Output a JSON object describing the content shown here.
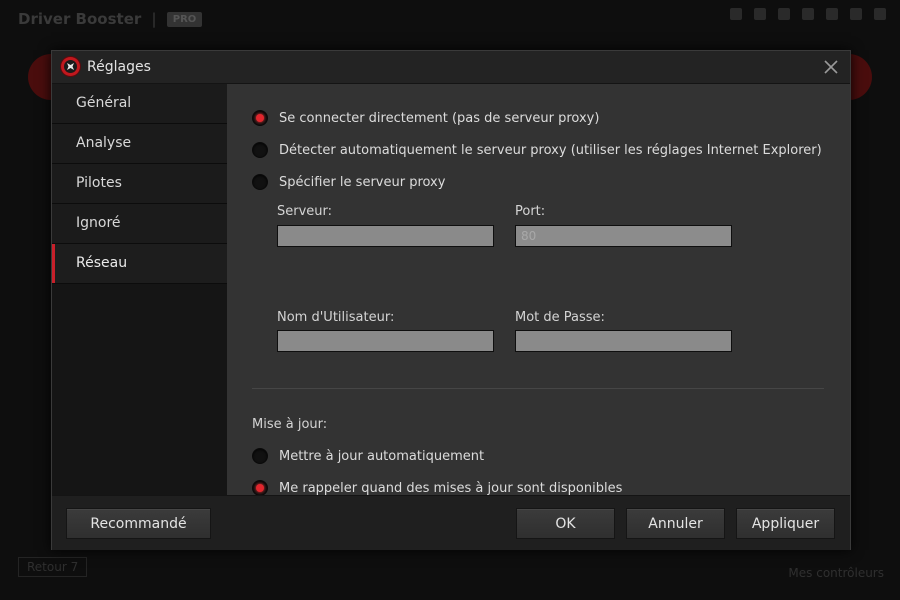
{
  "background": {
    "title": "Driver Booster",
    "badge": "PRO",
    "footer_left": "Retour 7",
    "footer_right": "Mes contrôleurs"
  },
  "dialog": {
    "title": "Réglages",
    "icons": {
      "logo": "app-logo-icon",
      "close": "close-icon"
    }
  },
  "sidebar": {
    "items": [
      {
        "label": "Général",
        "active": false
      },
      {
        "label": "Analyse",
        "active": false
      },
      {
        "label": "Pilotes",
        "active": false
      },
      {
        "label": "Ignoré",
        "active": false
      },
      {
        "label": "Réseau",
        "active": true
      }
    ]
  },
  "network": {
    "proxy_options": [
      {
        "label": "Se connecter directement (pas de serveur proxy)",
        "checked": true
      },
      {
        "label": "Détecter automatiquement le serveur proxy (utiliser les réglages Internet Explorer)",
        "checked": false
      },
      {
        "label": "Spécifier le serveur proxy",
        "checked": false
      }
    ],
    "server_label": "Serveur:",
    "server_value": "",
    "port_label": "Port:",
    "port_placeholder": "80",
    "username_label": "Nom d'Utilisateur:",
    "username_value": "",
    "password_label": "Mot de Passe:",
    "password_value": "",
    "update_label": "Mise à jour:",
    "update_options": [
      {
        "label": "Mettre à jour automatiquement",
        "checked": false
      },
      {
        "label": "Me rappeler quand des mises à jour sont disponibles",
        "checked": true
      }
    ]
  },
  "footer": {
    "recommended_label": "Recommandé",
    "ok_label": "OK",
    "cancel_label": "Annuler",
    "apply_label": "Appliquer"
  },
  "colors": {
    "accent": "#e0262d",
    "background": "#333333",
    "sidebar": "#1b1b1b"
  }
}
